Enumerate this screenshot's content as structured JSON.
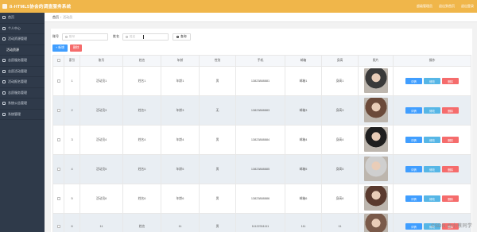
{
  "app": {
    "title": "ß-HTML5协会的调查服务系统",
    "top_links": [
      "超级管理员",
      "退出到首页",
      "退出登录"
    ]
  },
  "sidebar": {
    "items": [
      {
        "label": "首页",
        "icon": "home-icon"
      },
      {
        "label": "个人中心",
        "icon": "user-icon"
      },
      {
        "label": "活动资源管理",
        "icon": "list-icon"
      },
      {
        "label": "活动资源",
        "icon": "",
        "sub": true
      },
      {
        "label": "志愿服务管理",
        "icon": "list-icon"
      },
      {
        "label": "志愿活动管理",
        "icon": "list-icon"
      },
      {
        "label": "活动报名管理",
        "icon": "list-icon"
      },
      {
        "label": "志愿服务管理",
        "icon": "list-icon"
      },
      {
        "label": "系统公告管理",
        "icon": "list-icon"
      },
      {
        "label": "系统管理",
        "icon": "gear-icon"
      }
    ]
  },
  "breadcrumb": {
    "home": "首页",
    "current": "活动员"
  },
  "search": {
    "field1_label": "账号",
    "field1_placeholder": "账号",
    "field2_label": "姓名",
    "field2_placeholder": "姓名",
    "button_label": "查询"
  },
  "actions": {
    "add_label": "+ 新增",
    "delete_label": "删除"
  },
  "table": {
    "headers": [
      "",
      "索引",
      "账号",
      "姓名",
      "年龄",
      "性别",
      "手机",
      "邮箱",
      "身高",
      "照片",
      "操作"
    ],
    "rows": [
      {
        "index": "1",
        "account": "活动员1",
        "name": "姓名1",
        "age": "年龄1",
        "gender": "男",
        "phone": "13823888881",
        "email": "邮箱1",
        "height": "身高1",
        "photo_color": "#3a3a3a"
      },
      {
        "index": "2",
        "account": "活动员3",
        "name": "姓名3",
        "age": "年龄3",
        "gender": "无",
        "phone": "13823888883",
        "email": "邮箱3",
        "height": "身高3",
        "photo_color": "#6b4a3a"
      },
      {
        "index": "3",
        "account": "活动员4",
        "name": "姓名4",
        "age": "年龄4",
        "gender": "男",
        "phone": "13823888884",
        "email": "邮箱4",
        "height": "身高4",
        "photo_color": "#1f1f1f"
      },
      {
        "index": "4",
        "account": "活动员5",
        "name": "姓名5",
        "age": "年龄5",
        "gender": "男",
        "phone": "13823888885",
        "email": "邮箱5",
        "height": "身高5",
        "photo_color": "#cfcfcf"
      },
      {
        "index": "5",
        "account": "活动员6",
        "name": "姓名6",
        "age": "年龄6",
        "gender": "男",
        "phone": "13823888886",
        "email": "邮箱6",
        "height": "身高6",
        "photo_color": "#5a3a2e"
      },
      {
        "index": "6",
        "account": "11",
        "name": "姓名",
        "age": "11",
        "gender": "男",
        "phone": "11122311111",
        "email": "111",
        "height": "11",
        "photo_color": "#7a5a4a"
      }
    ],
    "op_detail": "详情",
    "op_edit": "修改",
    "op_delete": "删除"
  },
  "watermark": "CSDN @小蔡同学"
}
